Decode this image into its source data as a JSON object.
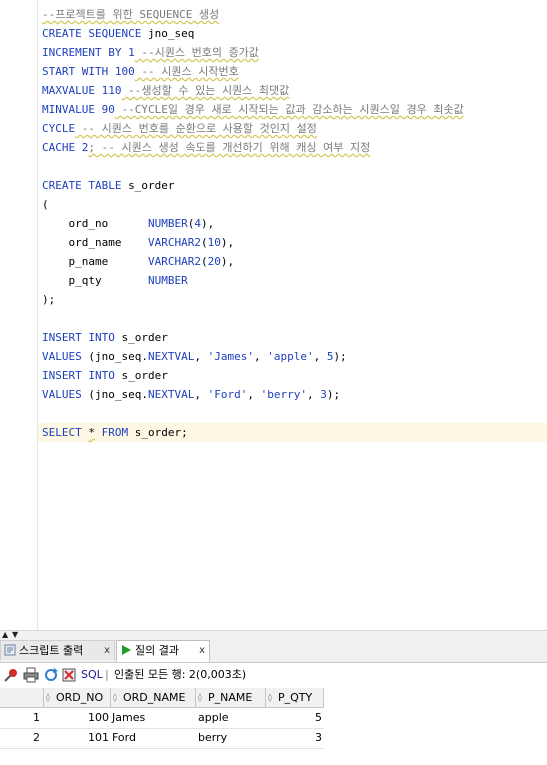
{
  "editor": {
    "lines": [
      {
        "segments": [
          {
            "t": "--프로젝트를 위한 SEQUENCE 생성",
            "c": "cm sq"
          }
        ]
      },
      {
        "segments": [
          {
            "t": "CREATE SEQUENCE",
            "c": "kw"
          },
          {
            "t": " jno_seq",
            "c": ""
          }
        ]
      },
      {
        "segments": [
          {
            "t": "INCREMENT BY",
            "c": "kw"
          },
          {
            "t": " ",
            "c": ""
          },
          {
            "t": "1",
            "c": "num"
          },
          {
            "t": " --시퀀스 번호의 증가값",
            "c": "cm sq"
          }
        ]
      },
      {
        "segments": [
          {
            "t": "START WITH",
            "c": "kw"
          },
          {
            "t": " ",
            "c": ""
          },
          {
            "t": "100",
            "c": "num"
          },
          {
            "t": " -- 시퀀스 시작번호",
            "c": "cm sq"
          }
        ]
      },
      {
        "segments": [
          {
            "t": "MAXVALUE",
            "c": "kw"
          },
          {
            "t": " ",
            "c": ""
          },
          {
            "t": "110",
            "c": "num"
          },
          {
            "t": " --생성할 수 있는 시퀀스 최댓값",
            "c": "cm sq"
          }
        ]
      },
      {
        "segments": [
          {
            "t": "MINVALUE",
            "c": "kw"
          },
          {
            "t": " ",
            "c": ""
          },
          {
            "t": "90",
            "c": "num"
          },
          {
            "t": " --CYCLE일 경우 새로 시작되는 값과 감소하는 시퀀스일 경우 최솟값",
            "c": "cm sq"
          }
        ]
      },
      {
        "segments": [
          {
            "t": "CYCLE",
            "c": "kw"
          },
          {
            "t": " -- 시퀀스 번호를 순환으로 사용할 것인지 설정",
            "c": "cm sq"
          }
        ]
      },
      {
        "segments": [
          {
            "t": "CACHE",
            "c": "kw"
          },
          {
            "t": " ",
            "c": ""
          },
          {
            "t": "2",
            "c": "num"
          },
          {
            "t": "; -- 시퀀스 생성 속도를 개선하기 위해 캐싱 여부 지정",
            "c": "cm sq"
          }
        ]
      },
      {
        "segments": []
      },
      {
        "segments": [
          {
            "t": "CREATE TABLE",
            "c": "kw"
          },
          {
            "t": " s_order",
            "c": ""
          }
        ]
      },
      {
        "segments": [
          {
            "t": "(",
            "c": ""
          }
        ]
      },
      {
        "segments": [
          {
            "t": "    ord_no      ",
            "c": ""
          },
          {
            "t": "NUMBER",
            "c": "ty"
          },
          {
            "t": "(",
            "c": ""
          },
          {
            "t": "4",
            "c": "num"
          },
          {
            "t": "),",
            "c": ""
          }
        ]
      },
      {
        "segments": [
          {
            "t": "    ord_name    ",
            "c": ""
          },
          {
            "t": "VARCHAR2",
            "c": "ty"
          },
          {
            "t": "(",
            "c": ""
          },
          {
            "t": "10",
            "c": "num"
          },
          {
            "t": "),",
            "c": ""
          }
        ]
      },
      {
        "segments": [
          {
            "t": "    p_name      ",
            "c": ""
          },
          {
            "t": "VARCHAR2",
            "c": "ty"
          },
          {
            "t": "(",
            "c": ""
          },
          {
            "t": "20",
            "c": "num"
          },
          {
            "t": "),",
            "c": ""
          }
        ]
      },
      {
        "segments": [
          {
            "t": "    p_qty       ",
            "c": ""
          },
          {
            "t": "NUMBER",
            "c": "ty"
          }
        ]
      },
      {
        "segments": [
          {
            "t": ");",
            "c": ""
          }
        ]
      },
      {
        "segments": []
      },
      {
        "segments": [
          {
            "t": "INSERT INTO",
            "c": "kw"
          },
          {
            "t": " s_order",
            "c": ""
          }
        ]
      },
      {
        "segments": [
          {
            "t": "VALUES",
            "c": "kw"
          },
          {
            "t": " (jno_seq.",
            "c": ""
          },
          {
            "t": "NEXTVAL",
            "c": "kw"
          },
          {
            "t": ", ",
            "c": ""
          },
          {
            "t": "'James'",
            "c": "str"
          },
          {
            "t": ", ",
            "c": ""
          },
          {
            "t": "'apple'",
            "c": "str"
          },
          {
            "t": ", ",
            "c": ""
          },
          {
            "t": "5",
            "c": "num"
          },
          {
            "t": ");",
            "c": ""
          }
        ]
      },
      {
        "segments": [
          {
            "t": "INSERT INTO",
            "c": "kw"
          },
          {
            "t": " s_order",
            "c": ""
          }
        ]
      },
      {
        "segments": [
          {
            "t": "VALUES",
            "c": "kw"
          },
          {
            "t": " (jno_seq.",
            "c": ""
          },
          {
            "t": "NEXTVAL",
            "c": "kw"
          },
          {
            "t": ", ",
            "c": ""
          },
          {
            "t": "'Ford'",
            "c": "str"
          },
          {
            "t": ", ",
            "c": ""
          },
          {
            "t": "'berry'",
            "c": "str"
          },
          {
            "t": ", ",
            "c": ""
          },
          {
            "t": "3",
            "c": "num"
          },
          {
            "t": ");",
            "c": ""
          }
        ]
      },
      {
        "segments": []
      },
      {
        "segments": [
          {
            "t": "SELECT",
            "c": "kw"
          },
          {
            "t": " ",
            "c": ""
          },
          {
            "t": "*",
            "c": "sq"
          },
          {
            "t": " ",
            "c": ""
          },
          {
            "t": "FROM",
            "c": "kw"
          },
          {
            "t": " s_order;",
            "c": ""
          }
        ],
        "current": true
      }
    ]
  },
  "tabs": {
    "script_output": "스크립트 출력",
    "query_result": "질의 결과",
    "close_glyph": "x"
  },
  "toolbar": {
    "sql_label": "SQL",
    "separator": "|",
    "status": "인출된 모든 행: 2(0,003초)"
  },
  "grid": {
    "columns": [
      "ORD_NO",
      "ORD_NAME",
      "P_NAME",
      "P_QTY"
    ],
    "rows": [
      {
        "num": "1",
        "ord_no": "100",
        "ord_name": "James",
        "p_name": "apple",
        "p_qty": "5"
      },
      {
        "num": "2",
        "ord_no": "101",
        "ord_name": "Ford",
        "p_name": "berry",
        "p_qty": "3"
      }
    ]
  },
  "colors": {
    "keyword": "#1d3fbd",
    "comment": "#7a7a7a",
    "current_line": "#fdf8e3",
    "run_icon": "#1e9a2e",
    "pin_icon": "#d62b2b"
  },
  "icons": [
    "pin-icon",
    "print-icon",
    "refresh-icon",
    "export-icon",
    "script-output-icon",
    "run-icon"
  ]
}
